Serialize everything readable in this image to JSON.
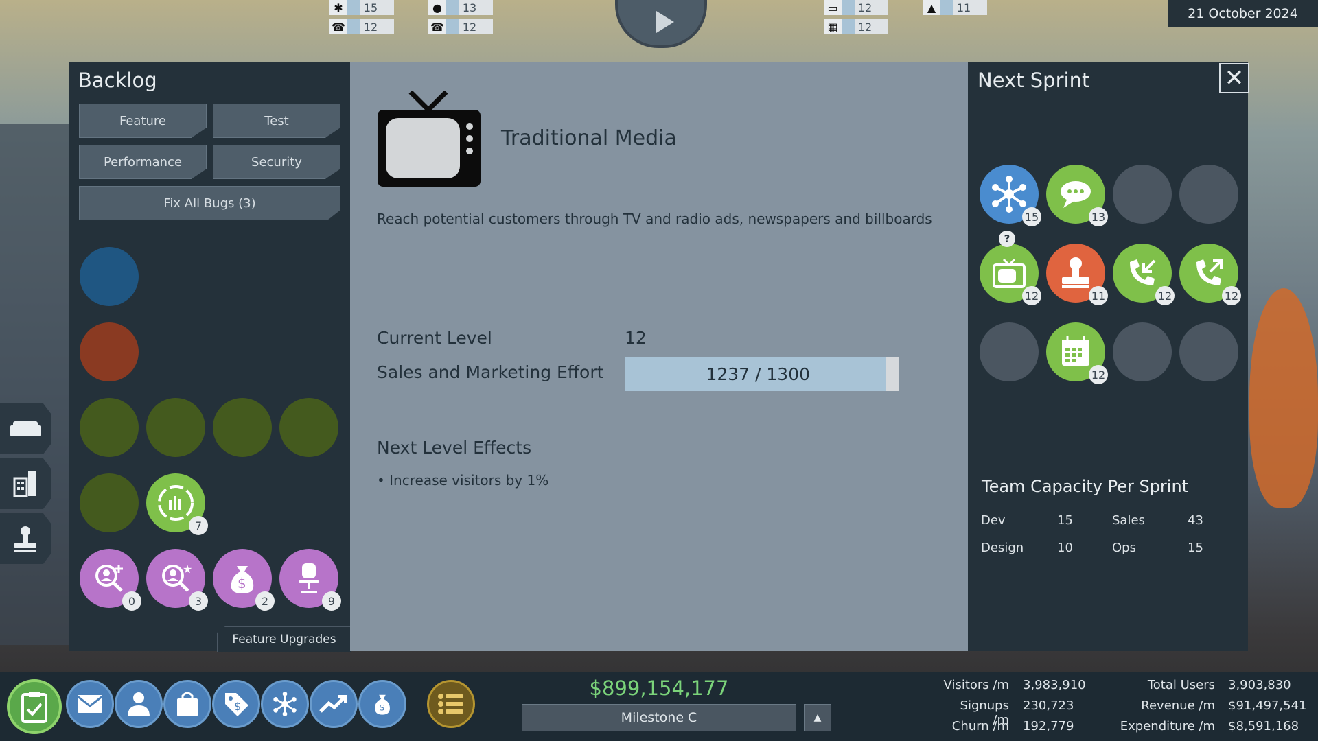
{
  "top_bar": {
    "stats": [
      {
        "icon": "network-icon",
        "value": "15"
      },
      {
        "icon": "phone-incoming-icon",
        "value": "12"
      },
      {
        "icon": "chat-icon",
        "value": "13"
      },
      {
        "icon": "phone-outgoing-icon",
        "value": "12"
      },
      {
        "icon": "tv-icon",
        "value": "12"
      },
      {
        "icon": "calendar-icon",
        "value": "12"
      },
      {
        "icon": "stamp-icon",
        "value": "11"
      }
    ],
    "date": "21 October 2024"
  },
  "backlog": {
    "title": "Backlog",
    "tabs": [
      "Feature",
      "Test",
      "Performance",
      "Security"
    ],
    "fix_bugs": "Fix All Bugs (3)",
    "items": [
      {
        "icon": "chart-icon",
        "count": "7"
      },
      {
        "icon": "search-plus-icon",
        "count": "0"
      },
      {
        "icon": "search-star-icon",
        "count": "3"
      },
      {
        "icon": "money-bag-icon",
        "count": "2"
      },
      {
        "icon": "office-chair-icon",
        "count": "9"
      }
    ],
    "upgrades_label": "Feature Upgrades"
  },
  "detail": {
    "title": "Traditional Media",
    "description": "Reach potential customers through TV and radio ads, newspapers and billboards",
    "current_level_label": "Current Level",
    "current_level": "12",
    "effort_label": "Sales and Marketing Effort",
    "effort_text": "1237 / 1300",
    "effort_progress": 0.9515,
    "next_effects_title": "Next Level Effects",
    "next_effects": "• Increase visitors by 1%"
  },
  "sprint": {
    "title": "Next Sprint",
    "items": [
      {
        "icon": "network-icon",
        "count": "15"
      },
      {
        "icon": "chat-icon",
        "count": "13"
      },
      {
        "icon": "tv-icon",
        "count": "12",
        "question": "?"
      },
      {
        "icon": "stamp-icon",
        "count": "11"
      },
      {
        "icon": "phone-incoming-icon",
        "count": "12"
      },
      {
        "icon": "phone-outgoing-icon",
        "count": "12"
      },
      {
        "icon": "calendar-icon",
        "count": "12"
      }
    ],
    "capacity_title": "Team Capacity Per Sprint",
    "capacity": [
      {
        "label": "Dev",
        "value": "15"
      },
      {
        "label": "Sales",
        "value": "43"
      },
      {
        "label": "Design",
        "value": "10"
      },
      {
        "label": "Ops",
        "value": "15"
      }
    ]
  },
  "bottom": {
    "money": "$899,154,177",
    "milestone": "Milestone C",
    "milestone_btn": "▲",
    "stats_left": [
      {
        "label": "Visitors /m",
        "value": "3,983,910"
      },
      {
        "label": "Signups /m",
        "value": "230,723"
      },
      {
        "label": "Churn /m",
        "value": "192,779"
      }
    ],
    "stats_right": [
      {
        "label": "Total Users",
        "value": "3,903,830"
      },
      {
        "label": "Revenue /m",
        "value": "$91,497,541"
      },
      {
        "label": "Expenditure /m",
        "value": "$8,591,168"
      }
    ]
  },
  "colors": {
    "dev_blue": "#4a8ccf",
    "sales_green": "#7fc04a",
    "design_orange": "#e0643f",
    "upgrade_purple": "#b774c9",
    "money_green": "#7bd37a"
  }
}
